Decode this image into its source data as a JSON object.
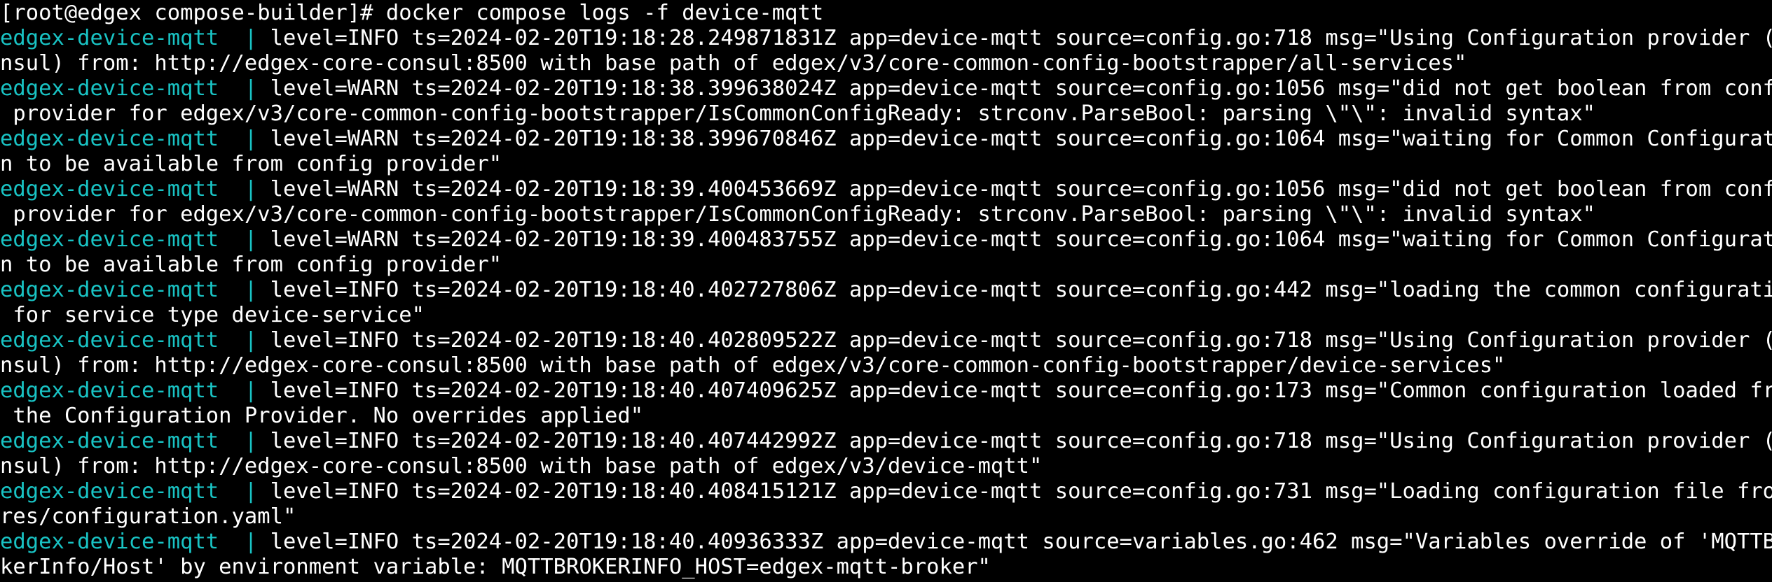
{
  "terminal": {
    "prompt": "[root@edgex compose-builder]# docker compose logs -f device-mqtt",
    "colors": {
      "background": "#000000",
      "text": "#ffffff",
      "service_prefix": "#19c3c4"
    },
    "lines": [
      {
        "prefix": "edgex-device-mqtt  | ",
        "text": "level=INFO ts=2024-02-20T19:18:28.249871831Z app=device-mqtt source=config.go:718 msg=\"Using Configuration provider (co"
      },
      {
        "prefix": "",
        "text": "nsul) from: http://edgex-core-consul:8500 with base path of edgex/v3/core-common-config-bootstrapper/all-services\""
      },
      {
        "prefix": "edgex-device-mqtt  | ",
        "text": "level=WARN ts=2024-02-20T19:18:38.399638024Z app=device-mqtt source=config.go:1056 msg=\"did not get boolean from config"
      },
      {
        "prefix": "",
        "text": " provider for edgex/v3/core-common-config-bootstrapper/IsCommonConfigReady: strconv.ParseBool: parsing \\\"\\\": invalid syntax\""
      },
      {
        "prefix": "edgex-device-mqtt  | ",
        "text": "level=WARN ts=2024-02-20T19:18:38.399670846Z app=device-mqtt source=config.go:1064 msg=\"waiting for Common Configuratio"
      },
      {
        "prefix": "",
        "text": "n to be available from config provider\""
      },
      {
        "prefix": "edgex-device-mqtt  | ",
        "text": "level=WARN ts=2024-02-20T19:18:39.400453669Z app=device-mqtt source=config.go:1056 msg=\"did not get boolean from config"
      },
      {
        "prefix": "",
        "text": " provider for edgex/v3/core-common-config-bootstrapper/IsCommonConfigReady: strconv.ParseBool: parsing \\\"\\\": invalid syntax\""
      },
      {
        "prefix": "edgex-device-mqtt  | ",
        "text": "level=WARN ts=2024-02-20T19:18:39.400483755Z app=device-mqtt source=config.go:1064 msg=\"waiting for Common Configuratio"
      },
      {
        "prefix": "",
        "text": "n to be available from config provider\""
      },
      {
        "prefix": "edgex-device-mqtt  | ",
        "text": "level=INFO ts=2024-02-20T19:18:40.402727806Z app=device-mqtt source=config.go:442 msg=\"loading the common configuration"
      },
      {
        "prefix": "",
        "text": " for service type device-service\""
      },
      {
        "prefix": "edgex-device-mqtt  | ",
        "text": "level=INFO ts=2024-02-20T19:18:40.402809522Z app=device-mqtt source=config.go:718 msg=\"Using Configuration provider (co"
      },
      {
        "prefix": "",
        "text": "nsul) from: http://edgex-core-consul:8500 with base path of edgex/v3/core-common-config-bootstrapper/device-services\""
      },
      {
        "prefix": "edgex-device-mqtt  | ",
        "text": "level=INFO ts=2024-02-20T19:18:40.407409625Z app=device-mqtt source=config.go:173 msg=\"Common configuration loaded from"
      },
      {
        "prefix": "",
        "text": " the Configuration Provider. No overrides applied\""
      },
      {
        "prefix": "edgex-device-mqtt  | ",
        "text": "level=INFO ts=2024-02-20T19:18:40.407442992Z app=device-mqtt source=config.go:718 msg=\"Using Configuration provider (co"
      },
      {
        "prefix": "",
        "text": "nsul) from: http://edgex-core-consul:8500 with base path of edgex/v3/device-mqtt\""
      },
      {
        "prefix": "edgex-device-mqtt  | ",
        "text": "level=INFO ts=2024-02-20T19:18:40.408415121Z app=device-mqtt source=config.go:731 msg=\"Loading configuration file from"
      },
      {
        "prefix": "",
        "text": "res/configuration.yaml\""
      },
      {
        "prefix": "edgex-device-mqtt  | ",
        "text": "level=INFO ts=2024-02-20T19:18:40.40936333Z app=device-mqtt source=variables.go:462 msg=\"Variables override of 'MQTTBro"
      },
      {
        "prefix": "",
        "text": "kerInfo/Host' by environment variable: MQTTBROKERINFO_HOST=edgex-mqtt-broker\""
      }
    ]
  }
}
